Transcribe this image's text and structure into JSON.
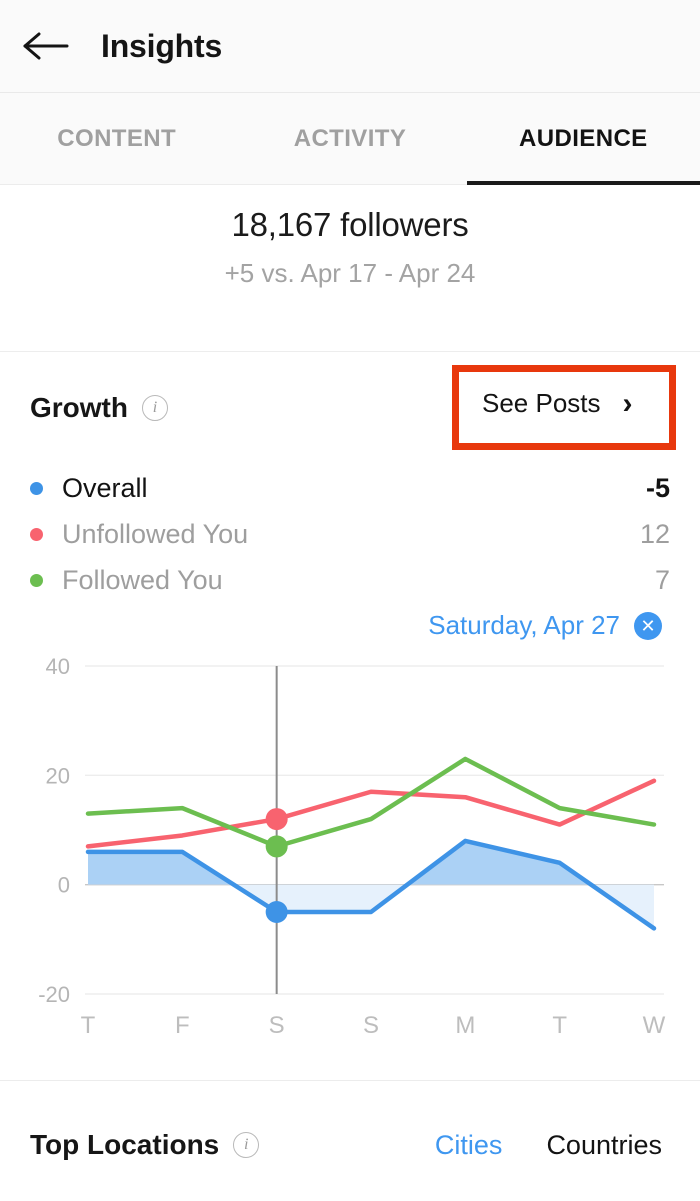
{
  "header": {
    "back_icon": "arrow-left-icon",
    "title": "Insights"
  },
  "tabs": [
    {
      "label": "CONTENT",
      "active": false
    },
    {
      "label": "ACTIVITY",
      "active": false
    },
    {
      "label": "AUDIENCE",
      "active": true
    }
  ],
  "summary": {
    "followers": "18,167 followers",
    "delta": "+5 vs. Apr 17 - Apr 24"
  },
  "growth": {
    "title": "Growth",
    "info_icon": "info-icon",
    "see_posts_label": "See Posts",
    "chevron_icon": "chevron-right-icon",
    "highlight_color": "#e8380d",
    "legend": [
      {
        "label": "Overall",
        "value": "-5",
        "color": "#3e93e6",
        "emphasis": true
      },
      {
        "label": "Unfollowed You",
        "value": "12",
        "color": "#f8636f",
        "emphasis": false
      },
      {
        "label": "Followed You",
        "value": "7",
        "color": "#6cbe50",
        "emphasis": false
      }
    ],
    "selected_date": "Saturday, Apr 27",
    "close_icon": "close-circle-icon"
  },
  "chart_data": {
    "type": "line",
    "title": "Growth",
    "xlabel": "",
    "ylabel": "",
    "x": [
      "T",
      "F",
      "S",
      "S",
      "M",
      "T",
      "W"
    ],
    "categories": [
      "T",
      "F",
      "S",
      "S",
      "M",
      "T",
      "W"
    ],
    "ylim": [
      -20,
      40
    ],
    "yticks": [
      40,
      20,
      0,
      -20
    ],
    "ytick_labels": [
      "40",
      "20",
      "0",
      "-20"
    ],
    "grid": true,
    "legend_position": "above",
    "selected_index": 2,
    "selected_label": "Saturday, Apr 27",
    "series": [
      {
        "name": "Overall",
        "color": "#3e93e6",
        "values": [
          6,
          6,
          -5,
          -5,
          8,
          4,
          -8
        ],
        "filled": true,
        "markers": [
          null,
          null,
          -5,
          null,
          null,
          null,
          null
        ]
      },
      {
        "name": "Unfollowed You",
        "color": "#f8636f",
        "values": [
          7,
          9,
          12,
          17,
          16,
          11,
          19
        ],
        "filled": false,
        "markers": [
          null,
          null,
          12,
          null,
          null,
          null,
          null
        ]
      },
      {
        "name": "Followed You",
        "color": "#6cbe50",
        "values": [
          13,
          14,
          7,
          12,
          23,
          14,
          11
        ],
        "filled": false,
        "markers": [
          null,
          null,
          7,
          null,
          null,
          null,
          null
        ]
      }
    ]
  },
  "top_locations": {
    "title": "Top Locations",
    "info_icon": "info-icon",
    "options": [
      {
        "label": "Cities",
        "selected": true
      },
      {
        "label": "Countries",
        "selected": false
      }
    ]
  }
}
